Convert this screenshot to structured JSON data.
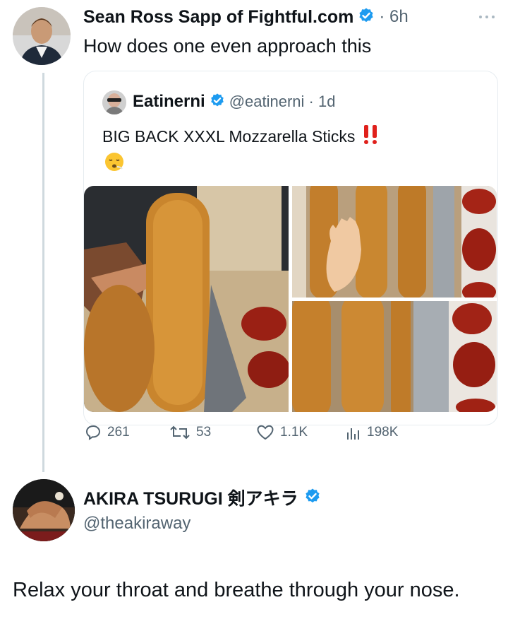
{
  "tweet": {
    "author_name": "Sean Ross Sapp of Fightful.com",
    "time": "· 6h",
    "text": "How does one even approach this",
    "more_icon": "more-dots-icon"
  },
  "quote": {
    "author_name": "Eatinerni",
    "handle": "@eatinerni · 1d",
    "text": "BIG BACK XXXL Mozzarella Sticks",
    "emoji_exclaim": "‼️",
    "emoji_face": "😮‍💨"
  },
  "actions": {
    "replies": "261",
    "retweets": "53",
    "likes": "1.1K",
    "views": "198K"
  },
  "reply": {
    "author_name": "AKIRA TSURUGI 剣アキラ",
    "handle": "@theakiraway",
    "text": "Relax your throat and breathe through your nose."
  },
  "colors": {
    "verified": "#1d9bf0",
    "muted": "#536471",
    "text": "#0f1419"
  }
}
